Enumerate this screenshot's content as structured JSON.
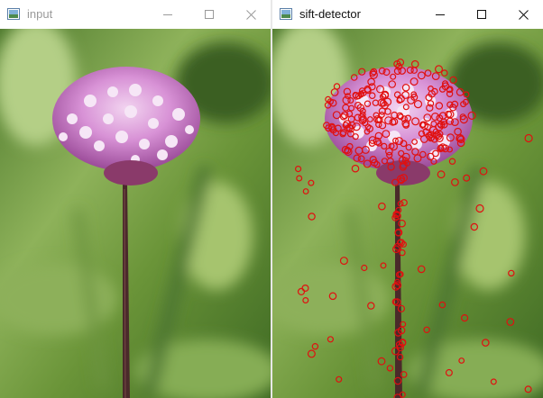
{
  "windows": [
    {
      "title": "input",
      "active": false,
      "controls": [
        "minimize-icon",
        "maximize-icon",
        "close-icon"
      ],
      "content": "flower-photo"
    },
    {
      "title": "sift-detector",
      "active": true,
      "controls": [
        "minimize-icon",
        "maximize-icon",
        "close-icon"
      ],
      "content": "flower-photo-with-sift-keypoints"
    }
  ],
  "colors": {
    "title_active": "#111111",
    "title_inactive": "#9a9a9a",
    "keypoint": "#e01010",
    "stem": "#4a2a2a",
    "flower": "#d58ad4",
    "background_green": "#6e9a3a"
  }
}
